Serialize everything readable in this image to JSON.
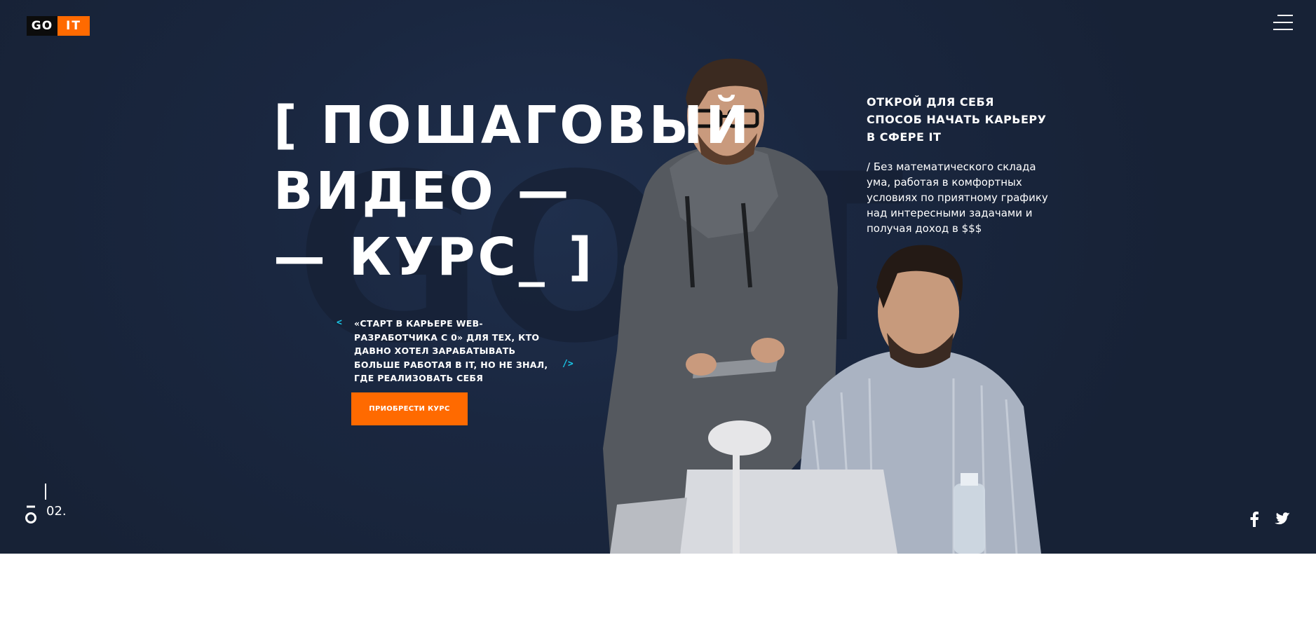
{
  "header": {
    "logo_go": "GO",
    "logo_it": "IT",
    "menu_icon": "hamburger-menu-icon"
  },
  "hero": {
    "watermark": "GOIT",
    "headline": [
      "[ ПОШАГОВЫЙ",
      "ВИДЕО —",
      "— КУРС_ ]"
    ],
    "subtitle_open": "<",
    "subtitle": "«СТАРТ В КАРЬЕРЕ WEB-РАЗРАБОТЧИКА С 0» ДЛЯ ТЕХ, КТО ДАВНО ХОТЕЛ ЗАРАБАТЫВАТЬ БОЛЬШЕ РАБОТАЯ В IT, НО НЕ ЗНАЛ, ГДЕ РЕАЛИЗОВАТЬ СЕБЯ",
    "subtitle_close": "/>",
    "cta_label": "ПРИОБРЕСТИ КУРС",
    "right_title": "ОТКРОЙ ДЛЯ СЕБЯ СПОСОБ НАЧАТЬ КАРЬЕРУ В СФЕРЕ IT",
    "right_text": "/ Без математического склада ума, работая в комфортных условиях по приятному графику над интересными задачами и получая доход в $$$"
  },
  "slider": {
    "current": "02."
  },
  "social": {
    "facebook_icon": "facebook-icon",
    "twitter_icon": "twitter-icon"
  },
  "colors": {
    "accent": "#ff6a00",
    "bracket": "#19c7e8",
    "background": "#1a2740"
  }
}
